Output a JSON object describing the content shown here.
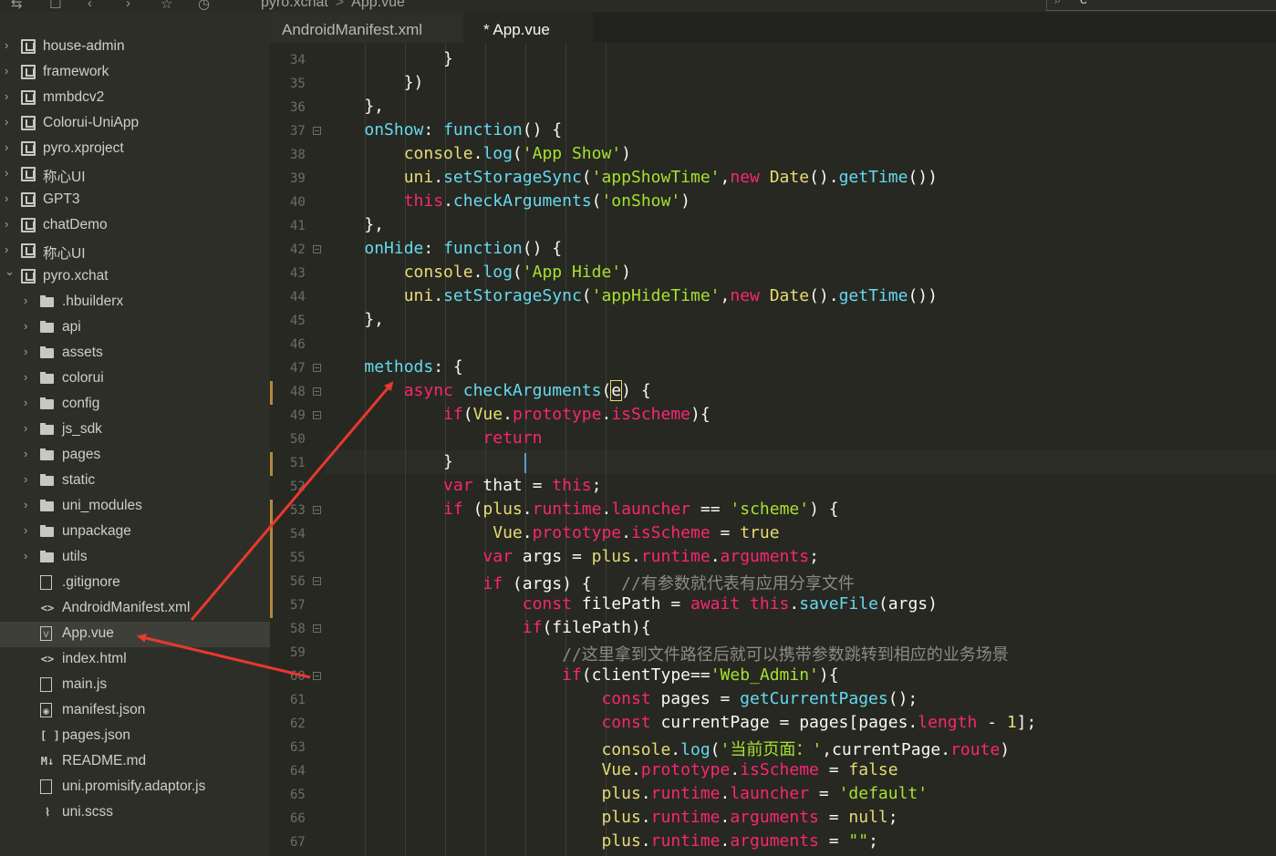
{
  "toolbar": {
    "breadcrumb": [
      "pyro.xchat",
      "App.vue"
    ],
    "search_value": "e",
    "icons": [
      "sync-icon",
      "save-icon",
      "back-icon",
      "forward-icon",
      "star-icon",
      "run-icon"
    ]
  },
  "sidebar": {
    "items": [
      {
        "label": "house-admin",
        "type": "project"
      },
      {
        "label": "framework",
        "type": "project"
      },
      {
        "label": "mmbdcv2",
        "type": "project"
      },
      {
        "label": "Colorui-UniApp",
        "type": "project"
      },
      {
        "label": "pyro.xproject",
        "type": "project"
      },
      {
        "label": "称心UI",
        "type": "project"
      },
      {
        "label": "GPT3",
        "type": "project"
      },
      {
        "label": "chatDemo",
        "type": "project"
      },
      {
        "label": "称心UI",
        "type": "project"
      },
      {
        "label": "pyro.xchat",
        "type": "project-open"
      },
      {
        "label": ".hbuilderx",
        "type": "folder"
      },
      {
        "label": "api",
        "type": "folder"
      },
      {
        "label": "assets",
        "type": "folder"
      },
      {
        "label": "colorui",
        "type": "folder"
      },
      {
        "label": "config",
        "type": "folder"
      },
      {
        "label": "js_sdk",
        "type": "folder"
      },
      {
        "label": "pages",
        "type": "folder"
      },
      {
        "label": "static",
        "type": "folder"
      },
      {
        "label": "uni_modules",
        "type": "folder"
      },
      {
        "label": "unpackage",
        "type": "folder"
      },
      {
        "label": "utils",
        "type": "folder"
      },
      {
        "label": ".gitignore",
        "type": "file"
      },
      {
        "label": "AndroidManifest.xml",
        "type": "xml"
      },
      {
        "label": "App.vue",
        "type": "vue"
      },
      {
        "label": "index.html",
        "type": "xml"
      },
      {
        "label": "main.js",
        "type": "js"
      },
      {
        "label": "manifest.json",
        "type": "json"
      },
      {
        "label": "pages.json",
        "type": "array"
      },
      {
        "label": "README.md",
        "type": "md"
      },
      {
        "label": "uni.promisify.adaptor.js",
        "type": "js"
      },
      {
        "label": "uni.scss",
        "type": "scss"
      }
    ],
    "selected": "App.vue"
  },
  "tabs": [
    {
      "label": "AndroidManifest.xml",
      "active": false
    },
    {
      "label": "* App.vue",
      "active": true
    }
  ],
  "editor": {
    "line_numbers": [
      "34",
      "35",
      "36",
      "37",
      "38",
      "39",
      "40",
      "41",
      "42",
      "43",
      "44",
      "45",
      "46",
      "47",
      "48",
      "49",
      "50",
      "51",
      "52",
      "53",
      "54",
      "55",
      "56",
      "57",
      "58",
      "59",
      "60",
      "61",
      "62",
      "63",
      "64",
      "65",
      "66",
      "67"
    ],
    "fold_lines": [
      "37",
      "42",
      "47",
      "48",
      "49",
      "53",
      "56",
      "58",
      "60"
    ],
    "modified_lines": [
      "48",
      "51",
      "53",
      "54",
      "55",
      "56",
      "57"
    ],
    "current_line": "51",
    "code_lines": [
      "            }",
      "        })",
      "    },",
      "    onShow: function() {",
      "        console.log('App Show')",
      "        uni.setStorageSync('appShowTime',new Date().getTime())",
      "        this.checkArguments('onShow')",
      "    },",
      "    onHide: function() {",
      "        console.log('App Hide')",
      "        uni.setStorageSync('appHideTime',new Date().getTime())",
      "    },",
      "",
      "    methods: {",
      "        async checkArguments(e) {",
      "            if(Vue.prototype.isScheme){",
      "                return",
      "            }",
      "            var that = this;",
      "            if (plus.runtime.launcher == 'scheme') {",
      "                 Vue.prototype.isScheme = true",
      "                var args = plus.runtime.arguments;",
      "                if (args) {   //有参数就代表有应用分享文件",
      "                    const filePath = await this.saveFile(args)",
      "                    if(filePath){",
      "                        //这里拿到文件路径后就可以携带参数跳转到相应的业务场景",
      "                        if(clientType=='Web_Admin'){",
      "                            const pages = getCurrentPages();",
      "                            const currentPage = pages[pages.length - 1];",
      "                            console.log('当前页面：',currentPage.route)",
      "                            Vue.prototype.isScheme = false",
      "                            plus.runtime.launcher = 'default'",
      "                            plus.runtime.arguments = null;",
      "                            plus.runtime.arguments = \"\";"
    ]
  },
  "annotations": {
    "arrow_color": "#e8382f"
  }
}
